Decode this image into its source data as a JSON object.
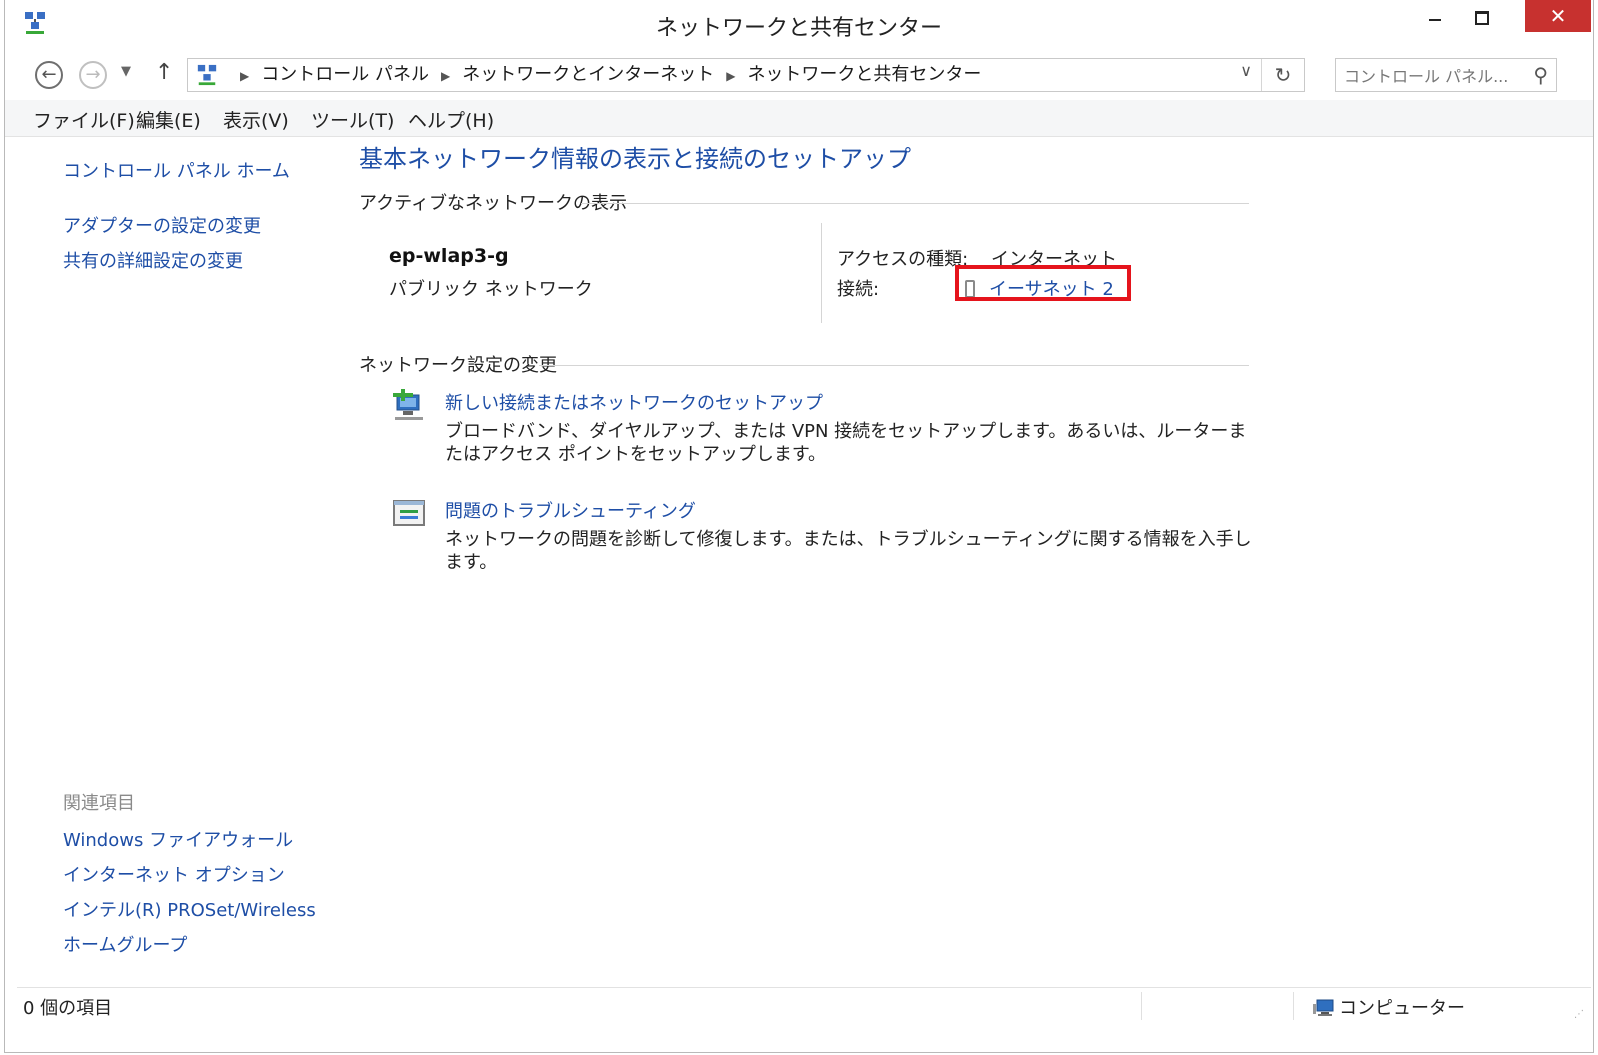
{
  "window": {
    "title": "ネットワークと共有センター",
    "close_glyph": "✕"
  },
  "nav": {
    "back_glyph": "←",
    "forward_glyph": "→",
    "up_glyph": "↑",
    "breadcrumbs": [
      "コントロール パネル",
      "ネットワークとインターネット",
      "ネットワークと共有センター"
    ],
    "search_placeholder": "コントロール パネル..."
  },
  "menu": [
    "ファイル(F)",
    "編集(E)",
    "表示(V)",
    "ツール(T)",
    "ヘルプ(H)"
  ],
  "sidebar": {
    "home": "コントロール パネル ホーム",
    "links": [
      "アダプターの設定の変更",
      "共有の詳細設定の変更"
    ],
    "related_caption": "関連項目",
    "related": [
      "Windows ファイアウォール",
      "インターネット オプション",
      "インテル(R) PROSet/Wireless",
      "ホームグループ"
    ]
  },
  "main": {
    "title": "基本ネットワーク情報の表示と接続のセットアップ",
    "active_section": "アクティブなネットワークの表示",
    "network_name": "ep-wlap3-g",
    "network_type": "パブリック ネットワーク",
    "access_label": "アクセスの種類:",
    "access_value": "インターネット",
    "connection_label": "接続:",
    "connection_value": "イーサネット 2",
    "change_section": "ネットワーク設定の変更",
    "tasks": [
      {
        "title": "新しい接続またはネットワークのセットアップ",
        "desc": "ブロードバンド、ダイヤルアップ、または VPN 接続をセットアップします。あるいは、ルーターまたはアクセス ポイントをセットアップします。",
        "icon": "network-setup-icon"
      },
      {
        "title": "問題のトラブルシューティング",
        "desc": "ネットワークの問題を診断して修復します。または、トラブルシューティングに関する情報を入手します。",
        "icon": "troubleshoot-icon"
      }
    ]
  },
  "status": {
    "count": "0 個の項目",
    "zone": "コンピューター"
  },
  "colors": {
    "link": "#1e4ea6",
    "close": "#c7312f",
    "highlight": "#e5141c"
  }
}
